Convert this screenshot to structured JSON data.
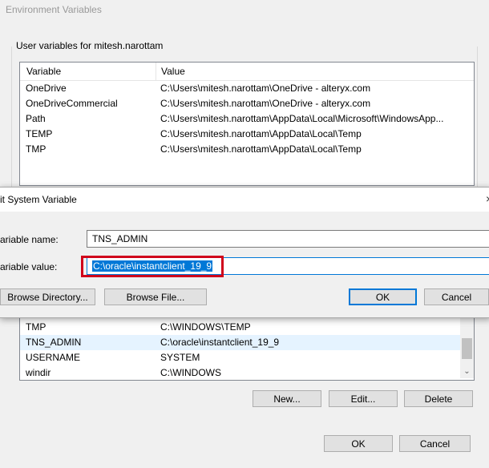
{
  "env": {
    "title": "Environment Variables",
    "user_group_label": "User variables for mitesh.narottam",
    "columns": {
      "variable": "Variable",
      "value": "Value"
    },
    "user_rows": [
      {
        "variable": "OneDrive",
        "value": "C:\\Users\\mitesh.narottam\\OneDrive - alteryx.com"
      },
      {
        "variable": "OneDriveCommercial",
        "value": "C:\\Users\\mitesh.narottam\\OneDrive - alteryx.com"
      },
      {
        "variable": "Path",
        "value": "C:\\Users\\mitesh.narottam\\AppData\\Local\\Microsoft\\WindowsApp..."
      },
      {
        "variable": "TEMP",
        "value": "C:\\Users\\mitesh.narottam\\AppData\\Local\\Temp"
      },
      {
        "variable": "TMP",
        "value": "C:\\Users\\mitesh.narottam\\AppData\\Local\\Temp"
      }
    ],
    "system_rows": [
      {
        "variable": "TMP",
        "value": "C:\\WINDOWS\\TEMP"
      },
      {
        "variable": "TNS_ADMIN",
        "value": "C:\\oracle\\instantclient_19_9"
      },
      {
        "variable": "USERNAME",
        "value": "SYSTEM"
      },
      {
        "variable": "windir",
        "value": "C:\\WINDOWS"
      }
    ],
    "buttons": {
      "new": "New...",
      "edit": "Edit...",
      "delete": "Delete",
      "ok": "OK",
      "cancel": "Cancel"
    }
  },
  "dialog": {
    "title": "it System Variable",
    "name_label": "ariable name:",
    "value_label": "ariable value:",
    "name_value": "TNS_ADMIN",
    "value_value": "C:\\oracle\\instantclient_19_9",
    "buttons": {
      "browse_directory": "Browse Directory...",
      "browse_file": "Browse File...",
      "ok": "OK",
      "cancel": "Cancel"
    },
    "close_glyph": "×"
  },
  "colors": {
    "accent": "#0078d7",
    "annotation": "#d0021b"
  }
}
